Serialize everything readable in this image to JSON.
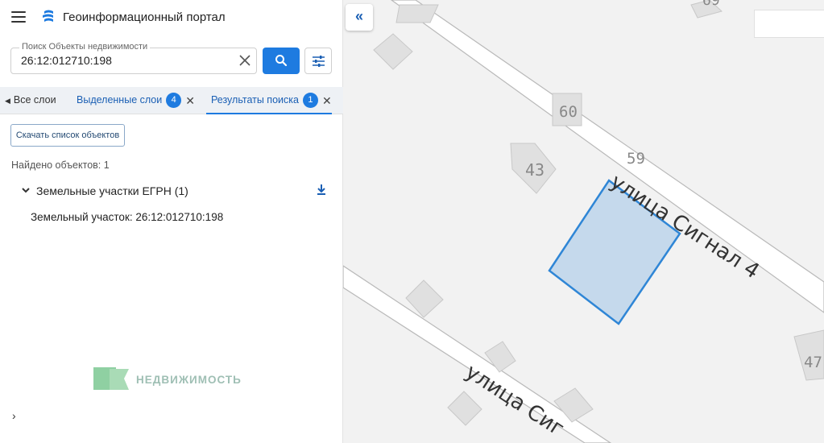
{
  "header": {
    "title": "Геоинформационный портал"
  },
  "search": {
    "legend": "Поиск Объекты недвижимости",
    "value": "26:12:012710:198"
  },
  "tabs": {
    "all": {
      "label": "Все слои"
    },
    "selected": {
      "label": "Выделенные слои",
      "count": "4"
    },
    "results": {
      "label": "Результаты поиска",
      "count": "1"
    }
  },
  "results": {
    "download_button": "Скачать список объектов",
    "found": "Найдено объектов: 1",
    "group_label": "Земельные участки ЕГРН (1)",
    "item_label": "Земельный участок: 26:12:012710:198"
  },
  "brand": {
    "name": "НЕДВИЖИМОСТЬ"
  },
  "map": {
    "street_main": "улица Сигнал 4",
    "street_lower": "улица Сиг",
    "house_numbers": [
      "69",
      "60",
      "59",
      "43",
      "47"
    ],
    "parcel_fill": "#c5d9ec",
    "parcel_stroke": "#2f86d6"
  },
  "colors": {
    "accent": "#1e7be0"
  }
}
